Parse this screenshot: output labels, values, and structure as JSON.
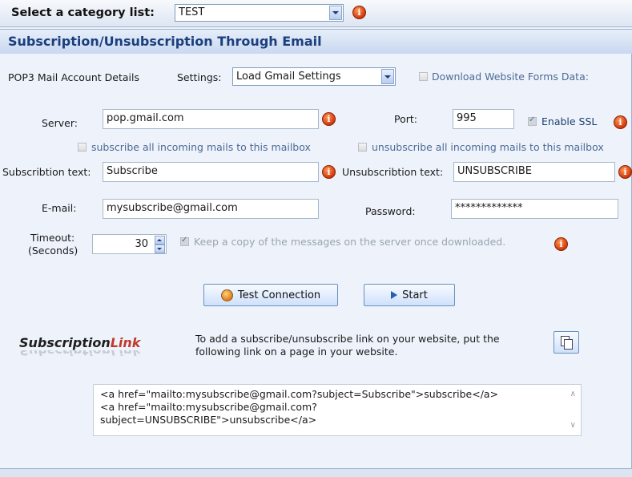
{
  "top": {
    "label": "Select a category list:",
    "category_value": "TEST"
  },
  "section_title": "Subscription/Unsubscription Through Email",
  "pop3": {
    "heading": "POP3 Mail Account Details",
    "settings_label": "Settings:",
    "settings_value": "Load Gmail Settings",
    "download_label": "Download Website Forms Data:"
  },
  "server": {
    "label": "Server:",
    "value": "pop.gmail.com"
  },
  "port": {
    "label": "Port:",
    "value": "995"
  },
  "ssl": {
    "label": "Enable SSL",
    "checked": true
  },
  "subscribe_all": "subscribe all incoming mails to this mailbox",
  "unsubscribe_all": "unsubscribe all incoming mails to this mailbox",
  "sub_text": {
    "label": "Subscribtion text:",
    "value": "Subscribe"
  },
  "unsub_text": {
    "label": "Unsubscribtion text:",
    "value": "UNSUBSCRIBE"
  },
  "email": {
    "label": "E-mail:",
    "value": "mysubscribe@gmail.com"
  },
  "password": {
    "label": "Password:",
    "value": "*************"
  },
  "timeout": {
    "label1": "Timeout:",
    "label2": "(Seconds)",
    "value": "30"
  },
  "keep_copy": "Keep a copy of the messages on the server once downloaded.",
  "buttons": {
    "test": "Test Connection",
    "start": "Start"
  },
  "logo": {
    "part1": "Subscription",
    "part2": "Link"
  },
  "link_help": {
    "line1": "To add a subscribe/unsubscribe link on your website, put the",
    "line2": "following link on a page in your website."
  },
  "code": {
    "line1": "<a href=\"mailto:mysubscribe@gmail.com?subject=Subscribe\">subscribe</a>",
    "line2": "<a href=\"mailto:mysubscribe@gmail.com?",
    "line3": "subject=UNSUBSCRIBE\">unsubscribe</a>"
  },
  "icons": [
    "info-icon",
    "copy-icon",
    "connect-icon",
    "play-icon"
  ],
  "colors": {
    "title": "#1b3f7e",
    "info": "#d2370a",
    "logo_link": "#c0392b"
  }
}
